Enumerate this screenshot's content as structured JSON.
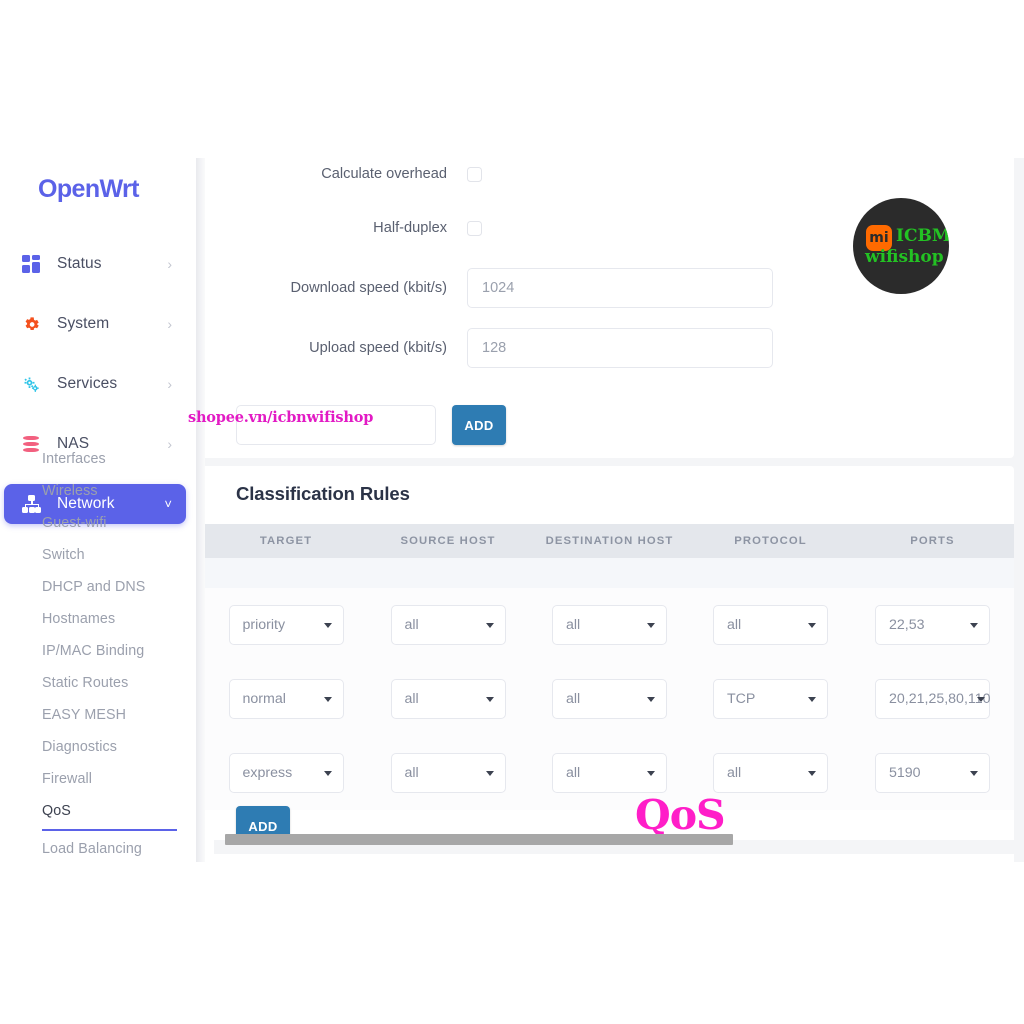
{
  "brand": {
    "name": "OpenWrt"
  },
  "sidebar": {
    "top_items": [
      {
        "label": "Status",
        "icon": "grid-icon",
        "chevron": "›",
        "active": false
      },
      {
        "label": "System",
        "icon": "gear-icon",
        "chevron": "›",
        "active": false
      },
      {
        "label": "Services",
        "icon": "gears-icon",
        "chevron": "›",
        "active": false
      },
      {
        "label": "NAS",
        "icon": "database-icon",
        "chevron": "›",
        "active": false
      },
      {
        "label": "Network",
        "icon": "sitemap-icon",
        "chevron": "˅",
        "active": true
      }
    ],
    "sub_items": [
      {
        "label": "Interfaces",
        "selected": false
      },
      {
        "label": "Wireless",
        "selected": false
      },
      {
        "label": "Guest-wifi",
        "selected": false
      },
      {
        "label": "Switch",
        "selected": false
      },
      {
        "label": "DHCP and DNS",
        "selected": false
      },
      {
        "label": "Hostnames",
        "selected": false
      },
      {
        "label": "IP/MAC Binding",
        "selected": false
      },
      {
        "label": "Static Routes",
        "selected": false
      },
      {
        "label": "EASY MESH",
        "selected": false
      },
      {
        "label": "Diagnostics",
        "selected": false
      },
      {
        "label": "Firewall",
        "selected": false
      },
      {
        "label": "QoS",
        "selected": true
      },
      {
        "label": "Load Balancing",
        "selected": false
      }
    ]
  },
  "form": {
    "fields": [
      {
        "label": "Calculate overhead",
        "type": "checkbox",
        "checked": false
      },
      {
        "label": "Half-duplex",
        "type": "checkbox",
        "checked": false
      },
      {
        "label": "Download speed (kbit/s)",
        "type": "text",
        "placeholder": "1024",
        "value": ""
      },
      {
        "label": "Upload speed (kbit/s)",
        "type": "text",
        "placeholder": "128",
        "value": ""
      }
    ]
  },
  "add_section": {
    "input_value": "",
    "input_placeholder": "",
    "add_label": "ADD"
  },
  "rules": {
    "title": "Classification Rules",
    "columns": [
      "TARGET",
      "SOURCE HOST",
      "DESTINATION HOST",
      "PROTOCOL",
      "PORTS"
    ],
    "rows": [
      {
        "target": "priority",
        "source_host": "all",
        "destination_host": "all",
        "protocol": "all",
        "ports": "22,53"
      },
      {
        "target": "normal",
        "source_host": "all",
        "destination_host": "all",
        "protocol": "TCP",
        "ports": "20,21,25,80,110"
      },
      {
        "target": "express",
        "source_host": "all",
        "destination_host": "all",
        "protocol": "all",
        "ports": "5190"
      }
    ],
    "add_label": "ADD"
  },
  "watermarks": {
    "shop_url": "shopee.vn/icbnwifishop",
    "qos_text": "QoS",
    "badge": {
      "mi_glyph": "mi",
      "line1": "ICBM",
      "line2": "wifishop"
    }
  },
  "colors": {
    "brand_indigo": "#5b62e8",
    "button_blue": "#2e7cb3",
    "watermark_magenta": "#e21ac4",
    "badge_green": "#23c223",
    "badge_orange": "#ff6a00"
  }
}
